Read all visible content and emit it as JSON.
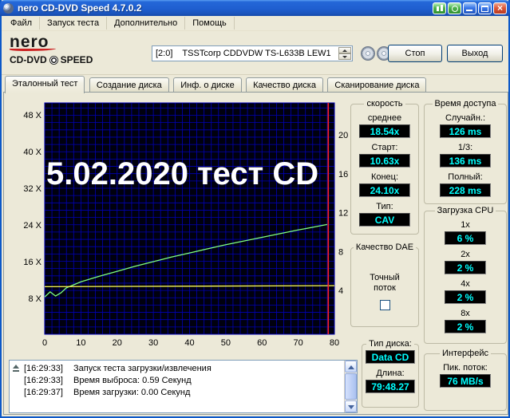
{
  "titlebar": {
    "title": "nero CD-DVD Speed 4.7.0.2"
  },
  "menu": {
    "items": [
      "Файл",
      "Запуск теста",
      "Дополнительно",
      "Помощь"
    ]
  },
  "toolbar": {
    "logo_line1": "nero",
    "logo_line2a": "CD-DVD",
    "logo_line2b": "SPEED",
    "drive": "[2:0]    TSSTcorp CDDVDW TS-L633B LEW1",
    "stop_label": "Стоп",
    "exit_label": "Выход"
  },
  "tabs": [
    "Эталонный тест",
    "Создание диска",
    "Инф. о диске",
    "Качество диска",
    "Сканирование диска"
  ],
  "chart_data": {
    "type": "line",
    "overlay_text": "5.02.2020 тест СD",
    "xlim": [
      0,
      80
    ],
    "x_ticks": [
      0,
      10,
      20,
      30,
      40,
      50,
      60,
      70,
      80
    ],
    "left_axis": {
      "label_suffix": " X",
      "ticks": [
        48,
        40,
        32,
        24,
        16,
        8
      ]
    },
    "right_axis": {
      "ticks": [
        20,
        16,
        12,
        8,
        4
      ]
    },
    "grid": true,
    "grid_color": "#0000b6",
    "plot_bg": "#00000e",
    "series": [
      {
        "name": "read-speed",
        "axis": "left",
        "color": "#7fff7f",
        "points": [
          [
            0,
            8.3
          ],
          [
            1.5,
            9.4
          ],
          [
            3,
            8.5
          ],
          [
            4.5,
            9.2
          ],
          [
            6,
            10.3
          ],
          [
            10,
            11.6
          ],
          [
            15,
            12.8
          ],
          [
            20,
            13.9
          ],
          [
            25,
            15.0
          ],
          [
            30,
            16.0
          ],
          [
            35,
            17.0
          ],
          [
            40,
            17.9
          ],
          [
            45,
            18.8
          ],
          [
            50,
            19.7
          ],
          [
            55,
            20.5
          ],
          [
            60,
            21.3
          ],
          [
            65,
            22.1
          ],
          [
            70,
            22.9
          ],
          [
            74,
            23.5
          ],
          [
            78,
            24.1
          ]
        ]
      },
      {
        "name": "rotation-speed",
        "axis": "right",
        "color": "#ffff55",
        "points": [
          [
            0,
            4.4
          ],
          [
            80,
            4.5
          ]
        ]
      }
    ],
    "end_marker": {
      "x": 78.3,
      "color": "#ff2222"
    }
  },
  "panels": {
    "speed": {
      "title": "скорость",
      "rows": [
        {
          "label": "среднее",
          "value": "18.54x"
        },
        {
          "label": "Старт:",
          "value": "10.63x"
        },
        {
          "label": "Конец:",
          "value": "24.10x"
        },
        {
          "label": "Тип:",
          "value": "CAV"
        }
      ]
    },
    "access": {
      "title": "Время доступа",
      "rows": [
        {
          "label": "Случайн.:",
          "value": "126 ms"
        },
        {
          "label": "1/3:",
          "value": "136 ms"
        },
        {
          "label": "Полный:",
          "value": "228 ms"
        }
      ]
    },
    "cpu": {
      "title": "Загрузка CPU",
      "rows": [
        {
          "label": "1x",
          "value": "6 %"
        },
        {
          "label": "2x",
          "value": "2 %"
        },
        {
          "label": "4x",
          "value": "2 %"
        },
        {
          "label": "8x",
          "value": "2 %"
        }
      ]
    },
    "dae": {
      "title": "Качество DAE",
      "option_label": "Точный поток",
      "checkbox_checked": false
    },
    "disc": {
      "title": "Тип диска:",
      "type_value": "Data CD",
      "length_label": "Длина:",
      "length_value": "79:48.27"
    },
    "iface": {
      "title": "Интерфейс",
      "peak_label": "Пик. поток:",
      "peak_value": "76 MB/s"
    }
  },
  "log": {
    "entries": [
      {
        "time": "[16:29:33]",
        "text": "Запуск теста загрузки/извлечения"
      },
      {
        "time": "[16:29:33]",
        "text": "Время выброса: 0.59 Секунд"
      },
      {
        "time": "[16:29:37]",
        "text": "Время загрузки: 0.00 Секунд"
      }
    ]
  },
  "colors": {
    "led_text": "#00ffff",
    "led_bg": "#000000",
    "accent_titlebar": "#1f5fd0"
  },
  "icons": {
    "app": "nero-disc",
    "titlebar_green_1": "chart",
    "titlebar_green_2": "disc",
    "minimize": "minimize",
    "maximize": "maximize",
    "close": "close",
    "toolbar_1": "cd",
    "toolbar_2": "cd",
    "log_first": "eject"
  }
}
